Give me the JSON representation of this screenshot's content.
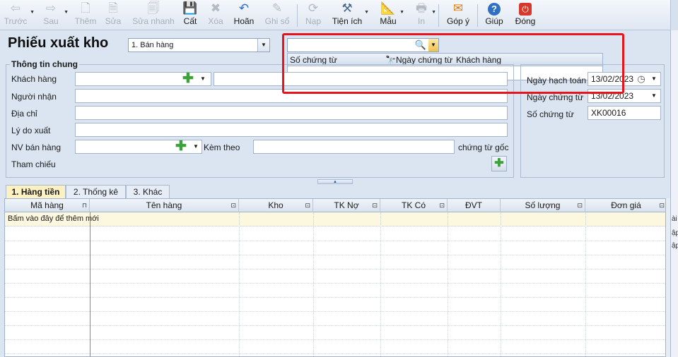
{
  "toolbar": {
    "items": [
      {
        "label": "Trước",
        "icon": "arrow-left-icon",
        "glyph": "⇦",
        "enabled": false
      },
      {
        "label": "Sau",
        "icon": "arrow-right-icon",
        "glyph": "⇨",
        "enabled": false
      },
      {
        "label": "Thêm",
        "icon": "new-document-icon",
        "glyph": "🗋",
        "enabled": false
      },
      {
        "label": "Sửa",
        "icon": "edit-document-icon",
        "glyph": "🗎",
        "enabled": false
      },
      {
        "label": "Sửa nhanh",
        "icon": "quick-edit-icon",
        "glyph": "🗐",
        "enabled": false
      },
      {
        "label": "Cất",
        "icon": "save-icon",
        "glyph": "💾",
        "enabled": true
      },
      {
        "label": "Xóa",
        "icon": "delete-icon",
        "glyph": "✖",
        "enabled": false
      },
      {
        "label": "Hoãn",
        "icon": "undo-icon",
        "glyph": "↶",
        "enabled": true
      },
      {
        "label": "Ghi sổ",
        "icon": "post-ledger-icon",
        "glyph": "✎",
        "enabled": false
      },
      {
        "label": "Nạp",
        "icon": "reload-icon",
        "glyph": "⟳",
        "enabled": false
      },
      {
        "label": "Tiện ích",
        "icon": "tools-icon",
        "glyph": "⚒",
        "enabled": true
      },
      {
        "label": "Mẫu",
        "icon": "template-icon",
        "glyph": "📐",
        "enabled": true
      },
      {
        "label": "In",
        "icon": "print-icon",
        "glyph": "🖶",
        "enabled": false
      },
      {
        "label": "Góp ý",
        "icon": "feedback-mail-icon",
        "glyph": "✉",
        "enabled": true
      },
      {
        "label": "Giúp",
        "icon": "help-icon",
        "glyph": "?",
        "enabled": true
      },
      {
        "label": "Đóng",
        "icon": "close-power-icon",
        "glyph": "⏻",
        "enabled": true
      }
    ]
  },
  "header": {
    "title": "Phiếu xuất kho",
    "type_value": "1. Bán hàng"
  },
  "search": {
    "value": "",
    "columns": [
      "Số chứng từ",
      "Ngày chứng từ",
      "Khách hàng"
    ]
  },
  "info": {
    "legend": "Thông tin chung",
    "customer_label": "Khách hàng",
    "receiver_label": "Người nhận",
    "address_label": "Địa chỉ",
    "reason_label": "Lý do xuất",
    "staff_label": "NV bán hàng",
    "attach_label": "Kèm theo",
    "original_docs_label": "chứng từ gốc",
    "reference_label": "Tham chiếu"
  },
  "dates": {
    "accounting_date_label": "Ngày hạch toán",
    "accounting_date_value": "13/02/2023",
    "doc_date_label": "Ngày chứng từ",
    "doc_date_value": "13/02/2023",
    "doc_no_label": "Số chứng từ",
    "doc_no_value": "XK00016"
  },
  "tabs": [
    {
      "label": "1. Hàng tiền",
      "active": true
    },
    {
      "label": "2. Thống kê",
      "active": false
    },
    {
      "label": "3. Khác",
      "active": false
    }
  ],
  "grid": {
    "columns": [
      "Mã hàng",
      "Tên hàng",
      "Kho",
      "TK Nợ",
      "TK Có",
      "ĐVT",
      "Số lượng",
      "Đơn giá"
    ],
    "new_row_hint": "Bấm vào đây để thêm mới"
  },
  "side_crop": {
    "row1": "ài",
    "row2": "ập",
    "row3": "ập"
  },
  "colors": {
    "highlight_border": "#e8141c",
    "background": "#dbe5f1",
    "active_tab": "#fdf1c2",
    "new_row": "#fcf8df"
  }
}
